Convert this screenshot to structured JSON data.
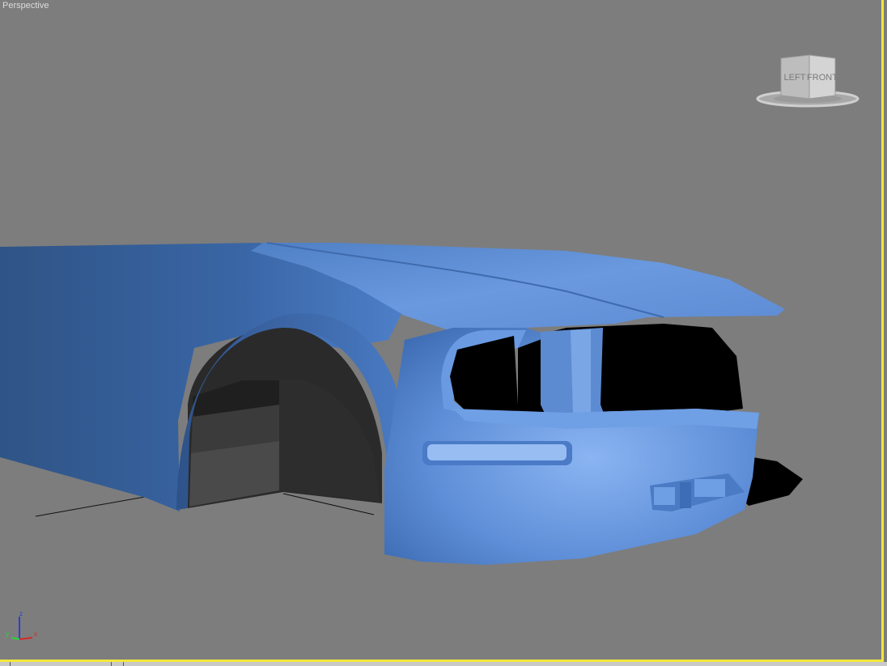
{
  "viewport": {
    "label": "Perspective",
    "active_border_color": "#f2e83a",
    "background_color": "#7d7d7d"
  },
  "viewcube": {
    "left_face": "LEFT",
    "front_face": "FRONT"
  },
  "axis_tripod": {
    "x": "x",
    "y": "y",
    "z": "z"
  },
  "model": {
    "color": "#5a8ad6"
  }
}
